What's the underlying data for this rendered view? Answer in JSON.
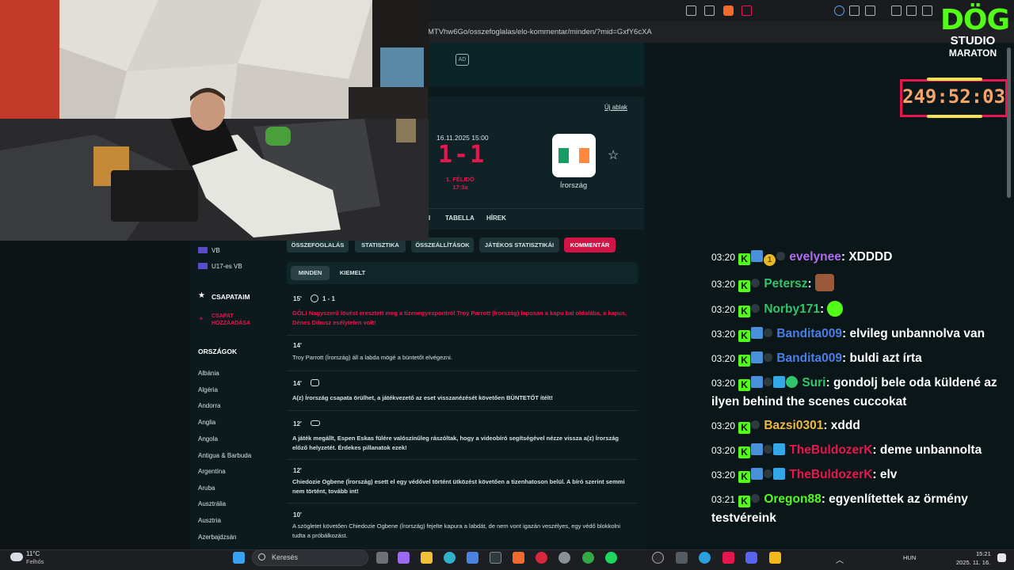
{
  "browser": {
    "url": "MTVhw6Go/osszefoglalas/elo-kommentar/minden/?mid=GxfY6cXA"
  },
  "site": {
    "ad_label": "AD",
    "new_window": "Új ablak",
    "match": {
      "date": "16.11.2025 15:00",
      "score": "1-1",
      "period": "1. FÉLIDŐ",
      "clock": "17:3a",
      "team_right": "Írország"
    },
    "nav_tabs": [
      "I",
      "TABELLA",
      "HÍREK"
    ],
    "sub_tabs": [
      "ÖSSZEFOGLALÁS",
      "STATISZTIKA",
      "ÖSSZEÁLLÍTÁSOK",
      "JÁTÉKOS STATISZTIKÁI",
      "KOMMENTÁR"
    ],
    "filters": [
      "MINDEN",
      "KIEMELT"
    ],
    "comments": [
      {
        "minute": "15'",
        "score": "1 - 1",
        "text": "GÓL! Nagyszerű lövést eresztett meg a tizenegyespontról Troy Parrott (Írország) laposan a kapu bal oldalába, a kapus, Dénes Dibusz esélytelen volt!"
      },
      {
        "minute": "14'",
        "text": "Troy Parrott (Írország) áll a labda mögé a büntetőt elvégezni."
      },
      {
        "minute": "14'",
        "text": "A(z) Írország csapata örülhet, a játékvezető az eset visszanézését követően BÜNTETŐT ítélt!"
      },
      {
        "minute": "12'",
        "text": "A játék megállt, Espen Eskas fülére valószínűleg rászóltak, hogy a videobíró segítségével nézze vissza a(z) Írország előző helyzetét. Érdekes pillanatok ezek!"
      },
      {
        "minute": "12'",
        "text": "Chiedozie Ogbene (Írország) esett el egy védővel történt ütközést követően a tizenhatoson belül. A bíró szerint semmi nem történt, tovább int!"
      },
      {
        "minute": "10'",
        "text": "A szögletet követően Chiedozie Ogbene (Írország) fejelte kapura a labdát, de nem vont igazán veszélyes, egy védő blokkolni tudta a próbálkozást."
      }
    ],
    "sidebar": {
      "competitions": [
        "VB",
        "U17-es VB"
      ],
      "my_teams": "CSAPATAIM",
      "add_team": "CSAPAT HOZZÁADÁSA",
      "countries_head": "ORSZÁGOK",
      "countries": [
        "Albánia",
        "Algéria",
        "Andorra",
        "Anglia",
        "Angola",
        "Antigua & Barbuda",
        "Argentína",
        "Aruba",
        "Ausztrália",
        "Ausztria",
        "Azerbajdzsán"
      ]
    }
  },
  "overlay": {
    "logo_top": "DÖG",
    "logo_mid": "STUDIO",
    "logo_bottom": "MARATON",
    "timer": "249:52:03"
  },
  "chat": [
    {
      "time": "03:20",
      "user": "evelynee",
      "color": "#b06ef0",
      "msg": "XDDDD"
    },
    {
      "time": "03:20",
      "user": "Petersz",
      "color": "#32c46c",
      "msg": ""
    },
    {
      "time": "03:20",
      "user": "Norby171",
      "color": "#32c46c",
      "msg": ""
    },
    {
      "time": "03:20",
      "user": "Bandita009",
      "color": "#4a7ee8",
      "msg": "elvileg unbannolva van"
    },
    {
      "time": "03:20",
      "user": "Bandita009",
      "color": "#4a7ee8",
      "msg": "buldi azt írta"
    },
    {
      "time": "03:20",
      "user": "Suri",
      "color": "#32c46c",
      "msg": "gondolj bele oda küldené az ilyen behind the scenes cuccokat"
    },
    {
      "time": "03:20",
      "user": "Bazsi0301",
      "color": "#f0b840",
      "msg": "xddd"
    },
    {
      "time": "03:20",
      "user": "TheBuldozerK",
      "color": "#e8164f",
      "msg": "deme unbannolta"
    },
    {
      "time": "03:20",
      "user": "TheBuldozerK",
      "color": "#e8164f",
      "msg": "elv"
    },
    {
      "time": "03:21",
      "user": "Oregon88",
      "color": "#53fc18",
      "msg": "egyenlítettek az örmény testvéreink"
    }
  ],
  "taskbar": {
    "weather_temp": "11°C",
    "weather_desc": "Felhős",
    "search": "Keresés",
    "lang": "HUN",
    "time": "15:21",
    "date": "2025. 11. 16."
  }
}
